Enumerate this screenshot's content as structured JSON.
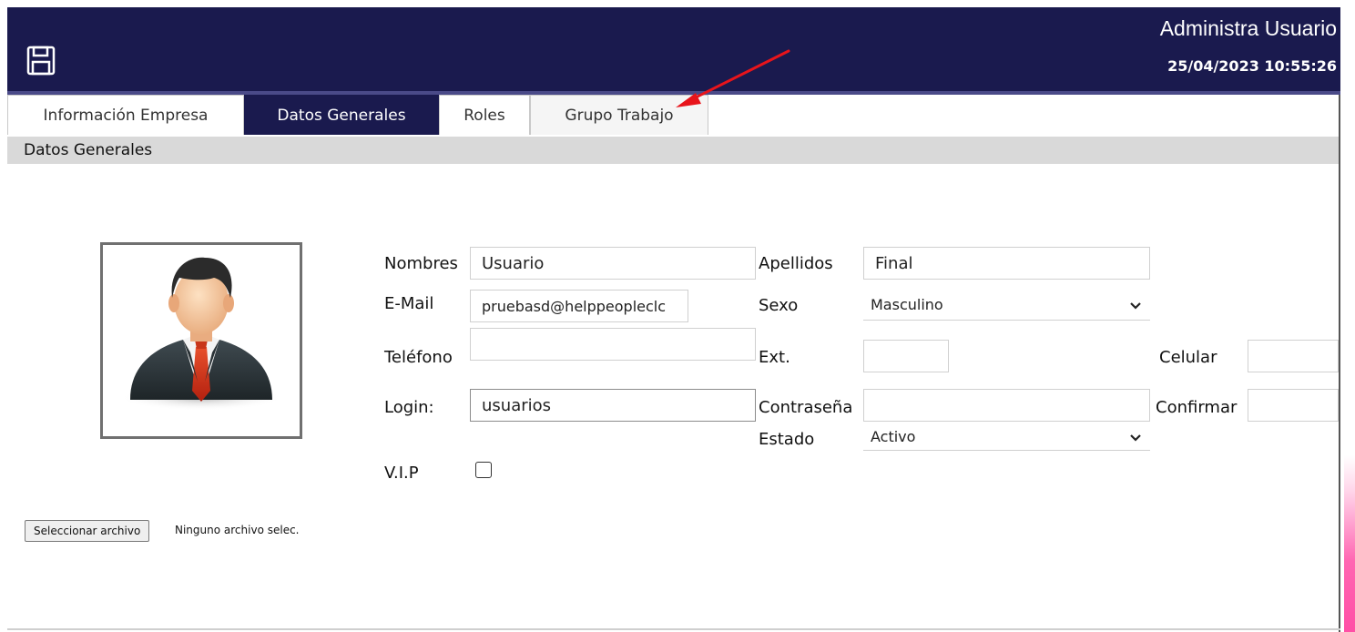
{
  "header": {
    "title": "Administra Usuario",
    "datetime": "25/04/2023 10:55:26",
    "save_icon": "save-icon",
    "bg_color": "#1a1a4e"
  },
  "tabs": [
    {
      "label": "Información Empresa",
      "active": false
    },
    {
      "label": "Datos Generales",
      "active": true
    },
    {
      "label": "Roles",
      "active": false
    },
    {
      "label": "Grupo Trabajo",
      "active": false
    }
  ],
  "section": {
    "title": "Datos Generales"
  },
  "form": {
    "nombres": {
      "label": "Nombres",
      "value": "Usuario"
    },
    "apellidos": {
      "label": "Apellidos",
      "value": "Final"
    },
    "email": {
      "label": "E-Mail",
      "value": "pruebasd@helppeopleclc"
    },
    "sexo": {
      "label": "Sexo",
      "value": "Masculino"
    },
    "telefono": {
      "label": "Teléfono",
      "value": ""
    },
    "ext": {
      "label": "Ext.",
      "value": ""
    },
    "celular": {
      "label": "Celular",
      "value": ""
    },
    "login": {
      "label": "Login:",
      "value": "usuarios"
    },
    "contrasena": {
      "label": "Contraseña",
      "value": ""
    },
    "confirmar": {
      "label": "Confirmar",
      "value": ""
    },
    "estado": {
      "label": "Estado",
      "value": "Activo"
    },
    "vip": {
      "label": "V.I.P",
      "checked": false
    }
  },
  "file": {
    "button_label": "Seleccionar archivo",
    "status": "Ninguno archivo selec."
  },
  "annotation": {
    "arrow_color": "#e8141b",
    "points_to": "tab-grupo-trabajo"
  }
}
